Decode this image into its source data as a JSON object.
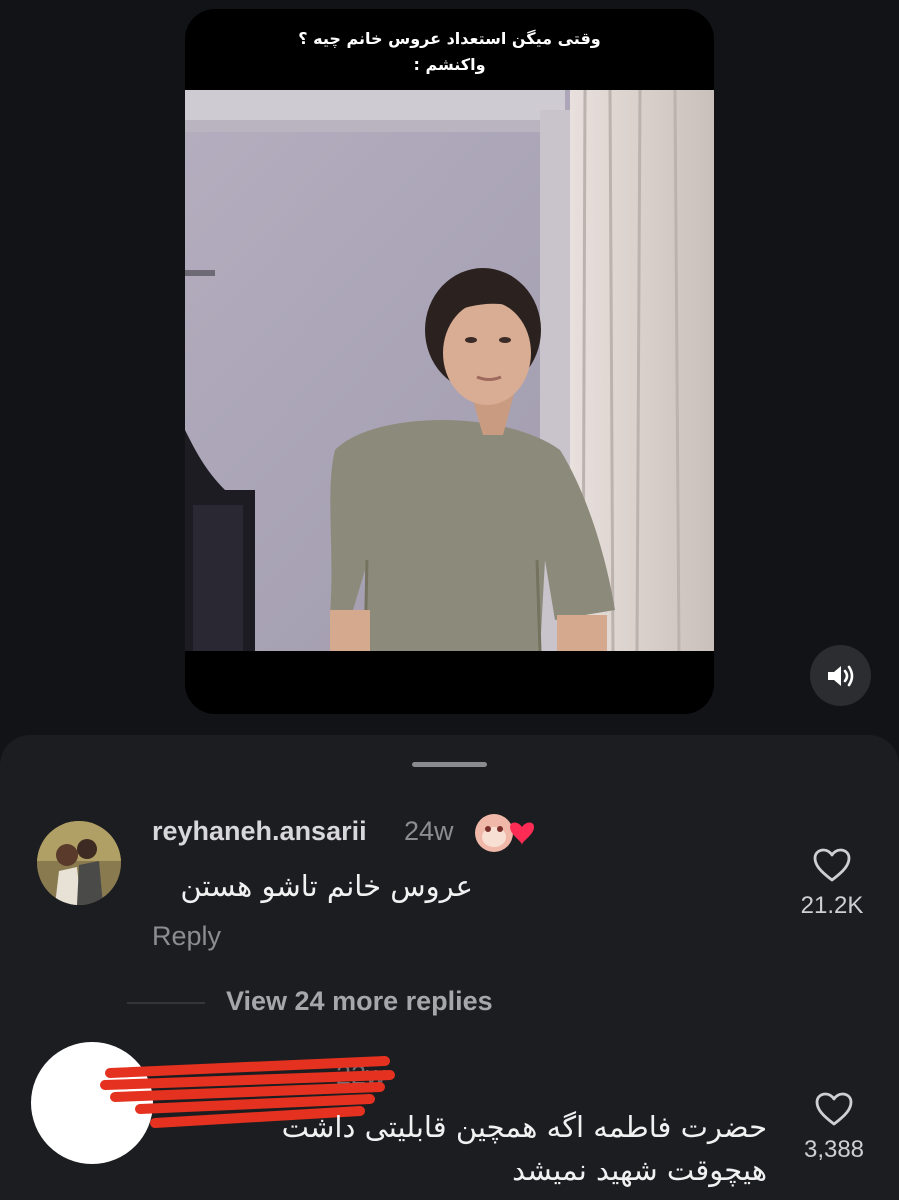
{
  "video": {
    "caption_line1": "وقتی میگن استعداد عروس خانم چیه ؟",
    "caption_line2": "واکنشم :",
    "mute_icon": "speaker-volume-icon"
  },
  "comments": [
    {
      "username": "reyhaneh.ansarii",
      "time": "24w",
      "text": "عروس خانم تاشو هستن",
      "reply_label": "Reply",
      "likes": "21.2K",
      "badge_icon": "sticker-heart-icon"
    },
    {
      "username": "",
      "time": "22w",
      "text_line1": "حضرت فاطمه اگه همچین قابلیتی داشت",
      "text_line2": "هیچوقت شهید نمیشد",
      "likes": "3,388"
    }
  ],
  "view_replies_label": "View 24 more replies",
  "colors": {
    "background": "#121316",
    "sheet": "#1c1d21",
    "heart_accent": "#fe2c55",
    "redaction": "#e5311f"
  }
}
